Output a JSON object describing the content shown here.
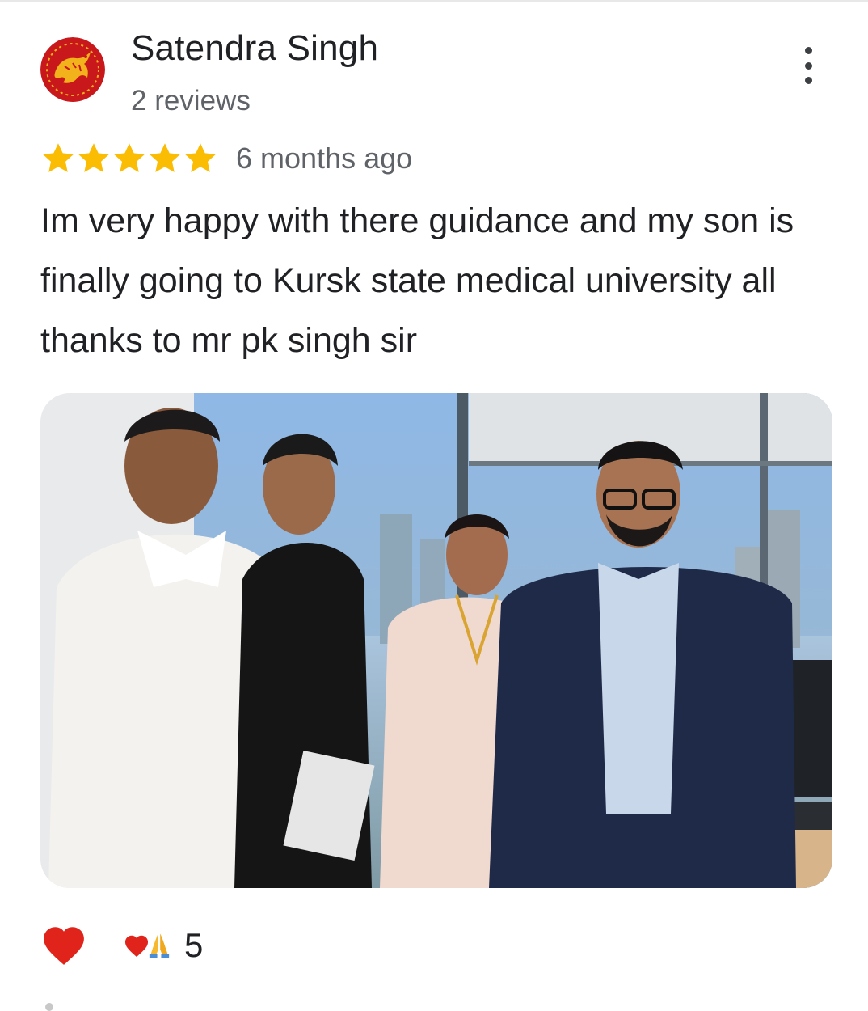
{
  "review": {
    "reviewer_name": "Satendra Singh",
    "review_count": "2 reviews",
    "rating": 5,
    "rating_max": 5,
    "time_ago": "6 months ago",
    "text": "Im very happy with there guidance and my son is finally going to Kursk state medical university all thanks to mr pk singh sir",
    "photo_alt": "Review photo",
    "reactions": {
      "icons": [
        "heart-icon",
        "praying-hands-icon"
      ],
      "count": "5"
    }
  },
  "colors": {
    "star": "#fbbc04",
    "heart": "#e0241b",
    "avatar_bg": "#c9181b",
    "avatar_accent": "#f2b21b",
    "secondary_text": "#5f6368"
  },
  "icons": {
    "avatar": "tiger-emblem-avatar",
    "menu": "more-vert-icon",
    "star": "star-icon",
    "like": "heart-icon"
  }
}
